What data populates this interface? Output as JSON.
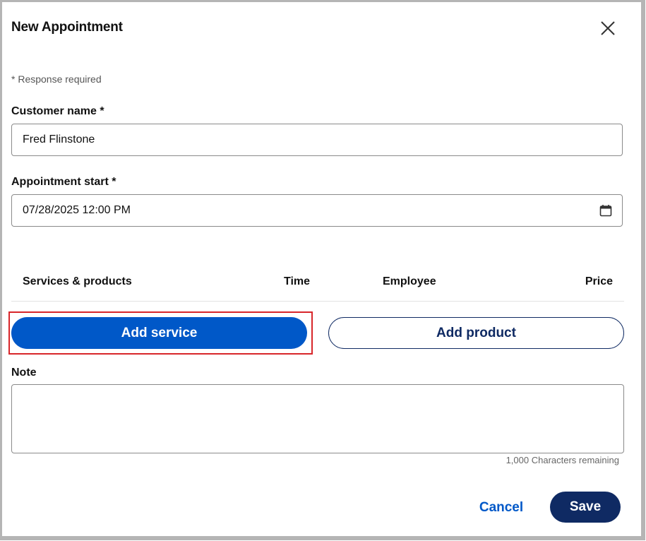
{
  "dialog": {
    "title": "New Appointment",
    "close_icon": "close-icon",
    "required_note": "* Response required"
  },
  "customer": {
    "label": "Customer name *",
    "value": "Fred Flinstone"
  },
  "appointment_start": {
    "label": "Appointment start *",
    "value": "07/28/2025 12:00 PM",
    "icon": "calendar-icon"
  },
  "table": {
    "headers": {
      "services": "Services & products",
      "time": "Time",
      "employee": "Employee",
      "price": "Price"
    }
  },
  "actions": {
    "add_service": "Add service",
    "add_product": "Add product"
  },
  "note": {
    "label": "Note",
    "value": "",
    "counter": "1,000 Characters remaining"
  },
  "footer": {
    "cancel": "Cancel",
    "save": "Save"
  },
  "colors": {
    "primary": "#0058c8",
    "navy": "#0f2a63",
    "highlight": "#d8262a"
  }
}
